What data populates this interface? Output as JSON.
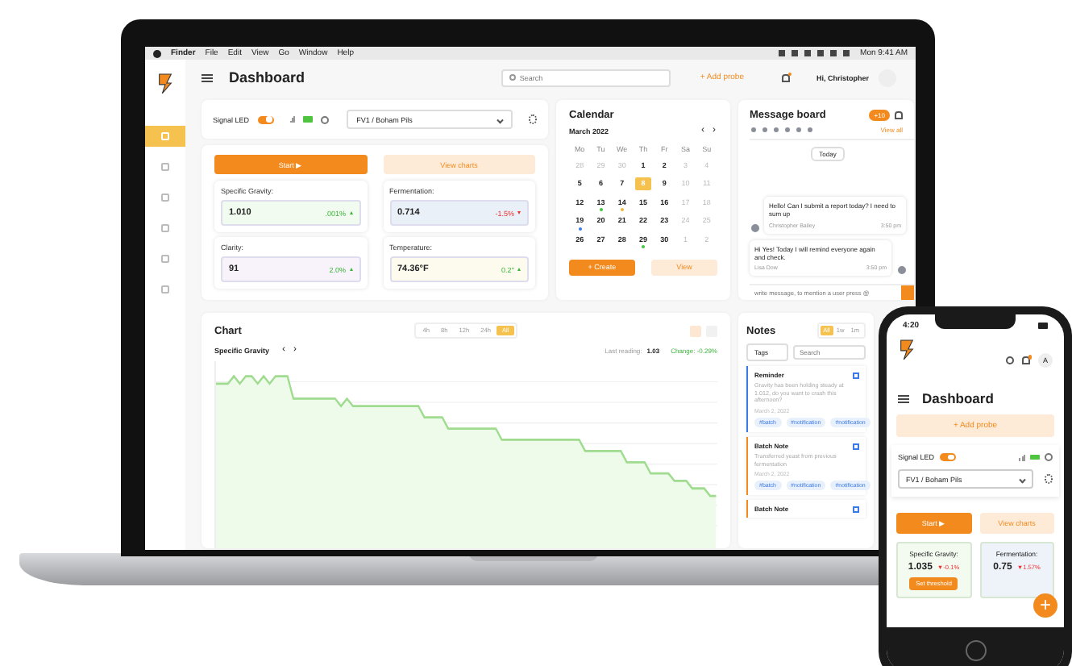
{
  "menu_bar": {
    "items": [
      "Finder",
      "File",
      "Edit",
      "View",
      "Go",
      "Window",
      "Help"
    ],
    "clock": "Mon 9:41 AM"
  },
  "sidebar": {
    "items": [
      {
        "selected": true
      },
      {
        "selected": false
      },
      {
        "selected": false
      },
      {
        "selected": false
      },
      {
        "selected": false
      },
      {
        "selected": false
      }
    ]
  },
  "header": {
    "title": "Dashboard",
    "search_placeholder": "Search",
    "add_probe": "+ Add probe",
    "greeting": "Hi, Christopher"
  },
  "probe": {
    "signal_label": "Signal LED",
    "signal_on": true,
    "probe_select": "FV1 / Boham Pils",
    "start": "Start ▶",
    "view_charts": "View charts",
    "readings": [
      {
        "label": "Specific Gravity:",
        "value": "1.010",
        "change": ".001%",
        "rising": true,
        "color": "#f1fbef"
      },
      {
        "label": "Fermentation:",
        "value": "0.714",
        "change": "-1.5%",
        "rising": false,
        "color": "#eaf0f8"
      },
      {
        "label": "Clarity:",
        "value": "91",
        "change": "2.0%",
        "rising": true,
        "color": "#f8f3fb"
      },
      {
        "label": "Temperature:",
        "value": "74.36°F",
        "change": "0.2°",
        "rising": true,
        "color": "#fdfbee"
      }
    ]
  },
  "calendar": {
    "title": "Calendar",
    "month": "March 2022",
    "prev": "‹",
    "next": "›",
    "weekdays": [
      "Mo",
      "Tu",
      "We",
      "Th",
      "Fr",
      "Sa",
      "Su"
    ],
    "days": [
      {
        "day": "28",
        "muted": true,
        "selected": false
      },
      {
        "day": "29",
        "muted": true,
        "selected": false
      },
      {
        "day": "30",
        "muted": true,
        "selected": false
      },
      {
        "day": "1",
        "muted": false,
        "selected": false
      },
      {
        "day": "2",
        "muted": false,
        "selected": false
      },
      {
        "day": "3",
        "muted": true,
        "selected": false
      },
      {
        "day": "4",
        "muted": true,
        "selected": false
      },
      {
        "day": "5",
        "muted": false,
        "selected": false
      },
      {
        "day": "6",
        "muted": false,
        "selected": false
      },
      {
        "day": "7",
        "muted": false,
        "selected": false
      },
      {
        "day": "8",
        "muted": false,
        "selected": true
      },
      {
        "day": "9",
        "muted": false,
        "selected": false
      },
      {
        "day": "10",
        "muted": true,
        "selected": false
      },
      {
        "day": "11",
        "muted": true,
        "selected": false
      },
      {
        "day": "12",
        "muted": false,
        "selected": false
      },
      {
        "day": "13",
        "muted": false,
        "selected": false,
        "color": "#3cc83c"
      },
      {
        "day": "14",
        "muted": false,
        "selected": false,
        "color": "#e8b63a"
      },
      {
        "day": "15",
        "muted": false,
        "selected": false
      },
      {
        "day": "16",
        "muted": false,
        "selected": false
      },
      {
        "day": "17",
        "muted": true,
        "selected": false
      },
      {
        "day": "18",
        "muted": true,
        "selected": false
      },
      {
        "day": "19",
        "muted": false,
        "selected": false,
        "color": "#3b7be8"
      },
      {
        "day": "20",
        "muted": false,
        "selected": false
      },
      {
        "day": "21",
        "muted": false,
        "selected": false
      },
      {
        "day": "22",
        "muted": false,
        "selected": false
      },
      {
        "day": "23",
        "muted": false,
        "selected": false
      },
      {
        "day": "24",
        "muted": true,
        "selected": false
      },
      {
        "day": "25",
        "muted": true,
        "selected": false
      },
      {
        "day": "26",
        "muted": false,
        "selected": false
      },
      {
        "day": "27",
        "muted": false,
        "selected": false
      },
      {
        "day": "28",
        "muted": false,
        "selected": false
      },
      {
        "day": "29",
        "muted": false,
        "selected": false,
        "color": "#3cc83c"
      },
      {
        "day": "30",
        "muted": false,
        "selected": false
      },
      {
        "day": "1",
        "muted": true,
        "selected": false
      },
      {
        "day": "2",
        "muted": true,
        "selected": false
      }
    ],
    "create": "+ Create",
    "view": "View"
  },
  "message_board": {
    "title": "Message board",
    "badge": "+10",
    "view_all": "View all",
    "day": "Today",
    "messages": [
      {
        "text": "Hello! Can I submit a report today? I need to sum up",
        "author": "Christopher Bailey",
        "time": "3:50 pm",
        "outgoing": false
      },
      {
        "text": "Hi Yes! Today I will remind everyone again and check.",
        "author": "Lisa Dow",
        "time": "3:50 pm",
        "outgoing": true
      }
    ],
    "input_placeholder": "write message, to mention a user press @"
  },
  "chart": {
    "title": "Chart",
    "subtitle": "Specific Gravity",
    "prev": "‹",
    "next": "›",
    "ranges": [
      {
        "label": "4h",
        "selected": false
      },
      {
        "label": "8h",
        "selected": false
      },
      {
        "label": "12h",
        "selected": false
      },
      {
        "label": "24h",
        "selected": false
      },
      {
        "label": "All",
        "selected": true
      }
    ],
    "last_reading_label": "Last reading:",
    "last_reading": "1.03",
    "change": "Change: -0.29%"
  },
  "notes": {
    "title": "Notes",
    "ranges": [
      {
        "label": "All",
        "selected": true
      },
      {
        "label": "1w",
        "selected": false
      },
      {
        "label": "1m",
        "selected": false
      }
    ],
    "tags_select": "Tags",
    "search_placeholder": "Search",
    "items": [
      {
        "title": "Reminder",
        "text": "Gravity has been holding steady at 1.012, do you want to crash this afternoon?",
        "date": "March 2, 2022",
        "tags": [
          "#batch",
          "#notification",
          "#notification"
        ],
        "color": "#3b7be8"
      },
      {
        "title": "Batch Note",
        "text": "Transferred yeast from previous fermentation",
        "date": "March 2, 2022",
        "tags": [
          "#batch",
          "#notification",
          "#notification"
        ],
        "color": "#f28a1e"
      },
      {
        "title": "Batch Note",
        "color": "#f28a1e"
      }
    ]
  },
  "phone": {
    "time": "4:20",
    "title": "Dashboard",
    "add_probe": "+ Add probe",
    "signal_label": "Signal LED",
    "signal_on": true,
    "probe_select": "FV1 / Boham Pils",
    "start": "Start ▶",
    "view_charts": "View charts",
    "readings": [
      {
        "label": "Specific Gravity:",
        "value": "1.035",
        "change": "▼-0.1%",
        "button": "Set threshold",
        "color": "#f3fbf0"
      },
      {
        "label": "Fermentation:",
        "value": "0.75",
        "change": "▼1.57%",
        "color": "#eef2f9"
      }
    ],
    "fab": "+",
    "avatar": "A"
  }
}
